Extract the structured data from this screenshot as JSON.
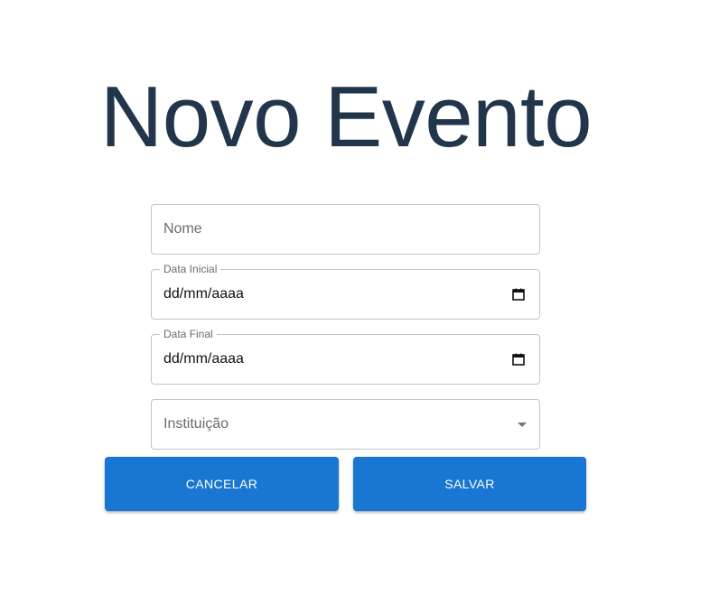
{
  "header": {
    "title": "Novo Evento"
  },
  "form": {
    "name_placeholder": "Nome",
    "start_date_label": "Data Inicial",
    "start_date_value": "dd/mm/aaaa",
    "end_date_label": "Data Final",
    "end_date_value": "dd/mm/aaaa",
    "institution_placeholder": "Instituição"
  },
  "actions": {
    "cancel_label": "CANCELAR",
    "save_label": "SALVAR"
  },
  "colors": {
    "title": "#22364b",
    "primary": "#1976d2",
    "border": "#c4c4c4"
  },
  "icons": {
    "date_picker": "calendar-icon",
    "select": "caret-down-icon"
  }
}
